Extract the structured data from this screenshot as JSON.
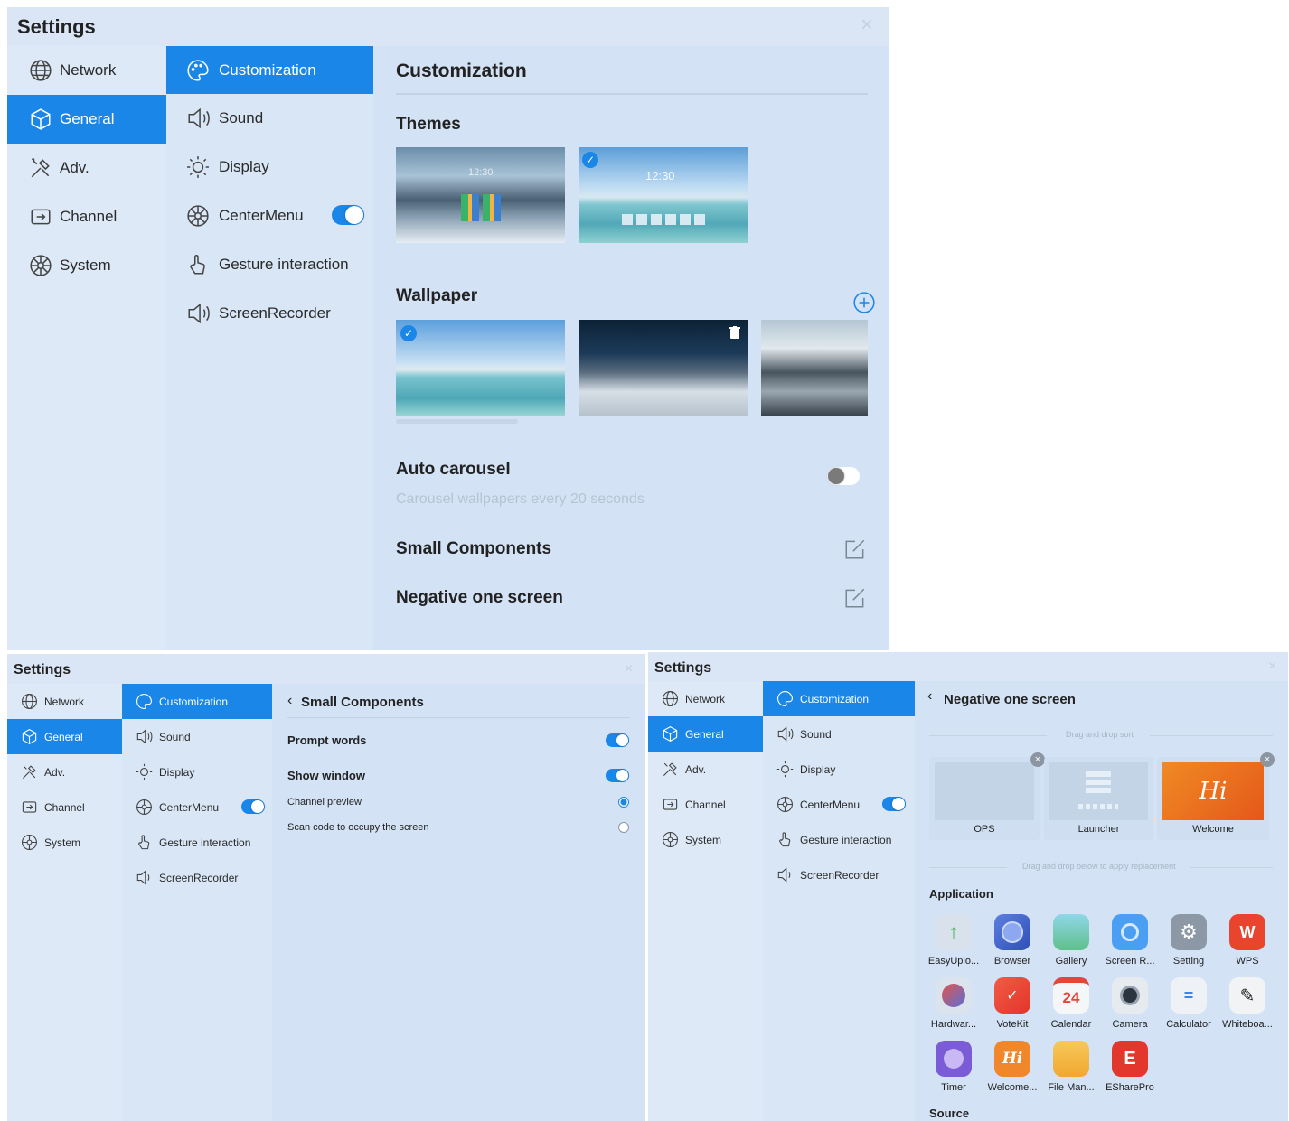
{
  "window_main": {
    "title": "Settings",
    "close": "×",
    "nav": [
      "Network",
      "General",
      "Adv.",
      "Channel",
      "System"
    ],
    "subnav": [
      "Customization",
      "Sound",
      "Display",
      "CenterMenu",
      "Gesture interaction",
      "ScreenRecorder"
    ],
    "heading": "Customization",
    "themes_label": "Themes",
    "wallpaper_label": "Wallpaper",
    "clock_text": "12:30",
    "auto_carousel": "Auto carousel",
    "carousel_sub": "Carousel wallpapers every 20 seconds",
    "small_components": "Small Components",
    "negative_one": "Negative one screen"
  },
  "window_small": {
    "title": "Settings",
    "close": "×",
    "nav": [
      "Network",
      "General",
      "Adv.",
      "Channel",
      "System"
    ],
    "subnav": [
      "Customization",
      "Sound",
      "Display",
      "CenterMenu",
      "Gesture interaction",
      "ScreenRecorder"
    ],
    "heading": "Small Components",
    "prompt_words": "Prompt words",
    "show_window": "Show window",
    "channel_preview": "Channel preview",
    "scan_code": "Scan code to occupy the screen"
  },
  "window_negative": {
    "title": "Settings",
    "close": "×",
    "nav": [
      "Network",
      "General",
      "Adv.",
      "Channel",
      "System"
    ],
    "subnav": [
      "Customization",
      "Sound",
      "Display",
      "CenterMenu",
      "Gesture interaction",
      "ScreenRecorder"
    ],
    "heading": "Negative one screen",
    "drag_sort": "Drag and drop sort",
    "screens": [
      "OPS",
      "Launcher",
      "Welcome"
    ],
    "welcome_logo": "Hi",
    "drag_replace": "Drag and drop below to apply replacement",
    "application_label": "Application",
    "apps": [
      "EasyUplo...",
      "Browser",
      "Gallery",
      "Screen R...",
      "Setting",
      "WPS",
      "Hardwar...",
      "VoteKit",
      "Calendar",
      "Camera",
      "Calculator",
      "Whiteboa...",
      "Timer",
      "Welcome...",
      "File Man...",
      "ESharePro"
    ],
    "calendar_day": "24",
    "source_label": "Source"
  },
  "colors": {
    "accent": "#1a86e8",
    "panel": "#dae6f6",
    "muted": "#b6c3d3"
  },
  "state": {
    "centermenu_enabled": true,
    "auto_carousel_enabled": false,
    "prompt_words_enabled": true,
    "show_window_enabled": true,
    "selected_theme": 2,
    "selected_wallpaper": 1,
    "selected_channel_option": "Channel preview"
  }
}
